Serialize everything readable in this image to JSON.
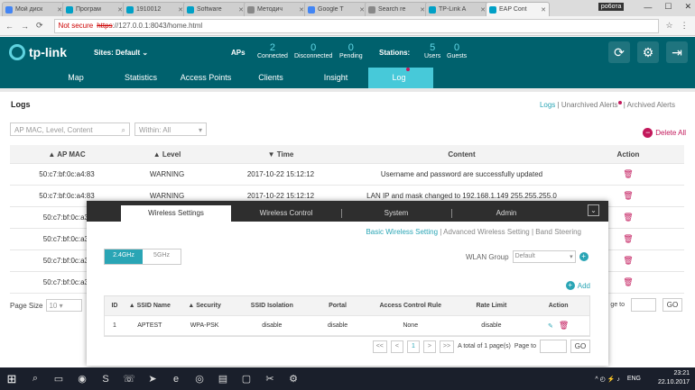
{
  "browser": {
    "tabs": [
      {
        "label": "Мой диск",
        "color": "#4285f4"
      },
      {
        "label": "Програм",
        "color": "#00a0c6"
      },
      {
        "label": "1910012",
        "color": "#00a0c6"
      },
      {
        "label": "Software",
        "color": "#00a0c6"
      },
      {
        "label": "Методич",
        "color": "#888888"
      },
      {
        "label": "Google T",
        "color": "#4285f4"
      },
      {
        "label": "Search re",
        "color": "#888888"
      },
      {
        "label": "TP-Link A",
        "color": "#00a0c6"
      },
      {
        "label": "EAP Cont",
        "color": "#00a0c6"
      }
    ],
    "user": "ро6ота",
    "address": {
      "not_secure": "Not secure",
      "scheme": "https",
      "rest": "://127.0.0.1:8043/home.html"
    }
  },
  "header": {
    "logo": "tp-link",
    "sites_label": "Sites:",
    "sites_value": "Default",
    "aps_label": "APs",
    "stats": [
      {
        "value": "2",
        "label": "Connected"
      },
      {
        "value": "0",
        "label": "Disconnected"
      },
      {
        "value": "0",
        "label": "Pending"
      }
    ],
    "stations_label": "Stations:",
    "station_stats": [
      {
        "value": "5",
        "label": "Users"
      },
      {
        "value": "0",
        "label": "Guests"
      }
    ]
  },
  "nav": [
    "Map",
    "Statistics",
    "Access Points",
    "Clients",
    "Insight",
    "Log"
  ],
  "logs": {
    "title": "Logs",
    "links": [
      "Logs",
      "Unarchived Alerts",
      "Archived Alerts"
    ],
    "search_placeholder": "AP MAC, Level, Content",
    "within": "Within: All",
    "delete_all": "Delete All",
    "columns": [
      "AP MAC",
      "Level",
      "Time",
      "Content",
      "Action"
    ],
    "rows": [
      {
        "mac": "50:c7:bf:0c:a4:83",
        "level": "WARNING",
        "time": "2017-10-22 15:12:12",
        "content": "Username and password are successfully updated"
      },
      {
        "mac": "50:c7:bf:0c:a4:83",
        "level": "WARNING",
        "time": "2017-10-22 15:12:12",
        "content": "LAN IP and mask changed to 192.168.1.149 255.255.255.0"
      },
      {
        "mac": "50:c7:bf:0c:a3:",
        "level": "",
        "time": "",
        "content": ""
      },
      {
        "mac": "50:c7:bf:0c:a3:",
        "level": "",
        "time": "",
        "content": ""
      },
      {
        "mac": "50:c7:bf:0c:a3:",
        "level": "",
        "time": "",
        "content": ""
      },
      {
        "mac": "50:c7:bf:0c:a3:",
        "level": "",
        "time": "",
        "content": ""
      }
    ],
    "page_size_label": "Page Size",
    "page_size": "10",
    "go_to_page": "ge to",
    "go": "GO"
  },
  "modal": {
    "tabs": [
      "Wireless Settings",
      "Wireless Control",
      "System",
      "Admin"
    ],
    "sublinks": [
      "Basic Wireless Setting",
      "Advanced Wireless Setting",
      "Band Steering"
    ],
    "bands": [
      "2.4GHz",
      "5GHz"
    ],
    "wlan_group_label": "WLAN Group",
    "wlan_group_value": "Default",
    "add_label": "Add",
    "columns": [
      "ID",
      "SSID Name",
      "Security",
      "SSID Isolation",
      "Portal",
      "Access Control Rule",
      "Rate Limit",
      "Action"
    ],
    "rows": [
      {
        "id": "1",
        "ssid": "APTEST",
        "security": "WPA-PSK",
        "isolation": "disable",
        "portal": "disable",
        "acl": "None",
        "rate": "disable"
      }
    ],
    "pager": {
      "first": "<<",
      "prev": "<",
      "current": "1",
      "next": ">",
      "last": ">>",
      "total": "A total of 1 page(s)",
      "page_to": "Page to",
      "go": "GO"
    }
  },
  "taskbar": {
    "lang": "ENG",
    "time": "23:21",
    "date": "22.10.2017"
  }
}
